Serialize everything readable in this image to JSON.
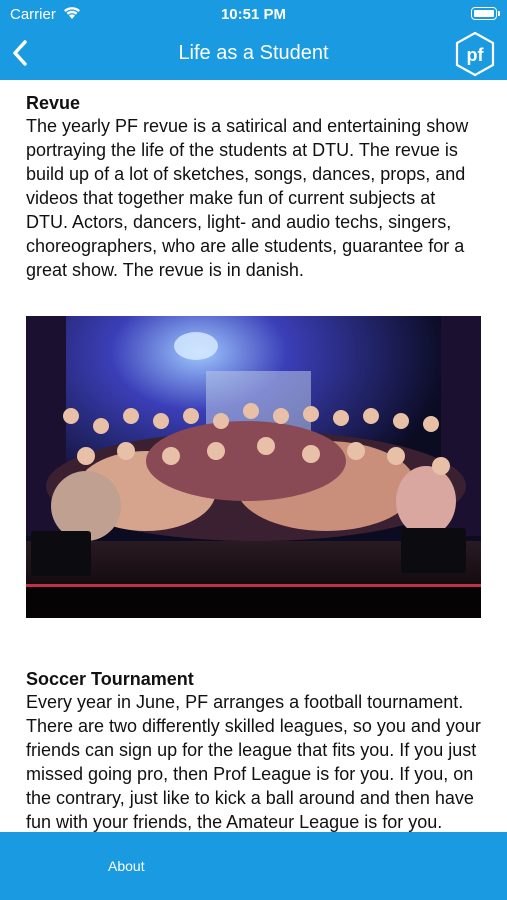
{
  "status": {
    "carrier": "Carrier",
    "time": "10:51 PM"
  },
  "nav": {
    "title": "Life as a Student",
    "logo_text": "pf"
  },
  "sections": [
    {
      "heading": "Revue",
      "body": "The yearly PF revue is a satirical and entertaining show portraying the life of the students at DTU. The revue is build up of a lot of sketches, songs, dances, props, and videos that together make fun of current subjects at DTU. Actors, dancers, light- and audio techs, singers, choreographers, who are alle students, guarantee for a great show. The revue is in danish."
    },
    {
      "heading": "Soccer Tournament",
      "body": "Every year in June, PF arranges a football tournament. There are two differently skilled leagues, so you and your friends can sign up for the league that fits you. If you just missed going pro, then Prof League is for you. If you, on the contrary, just like to kick a ball around and then have fun with your friends, the Amateur League is for you."
    }
  ],
  "tabbar": {
    "about_label": "About"
  },
  "colors": {
    "brand": "#1a9ae0",
    "text": "#111111"
  },
  "icons": {
    "back": "chevron-left-icon",
    "logo": "pf-logo-icon",
    "wifi": "wifi-icon",
    "battery": "battery-icon"
  }
}
